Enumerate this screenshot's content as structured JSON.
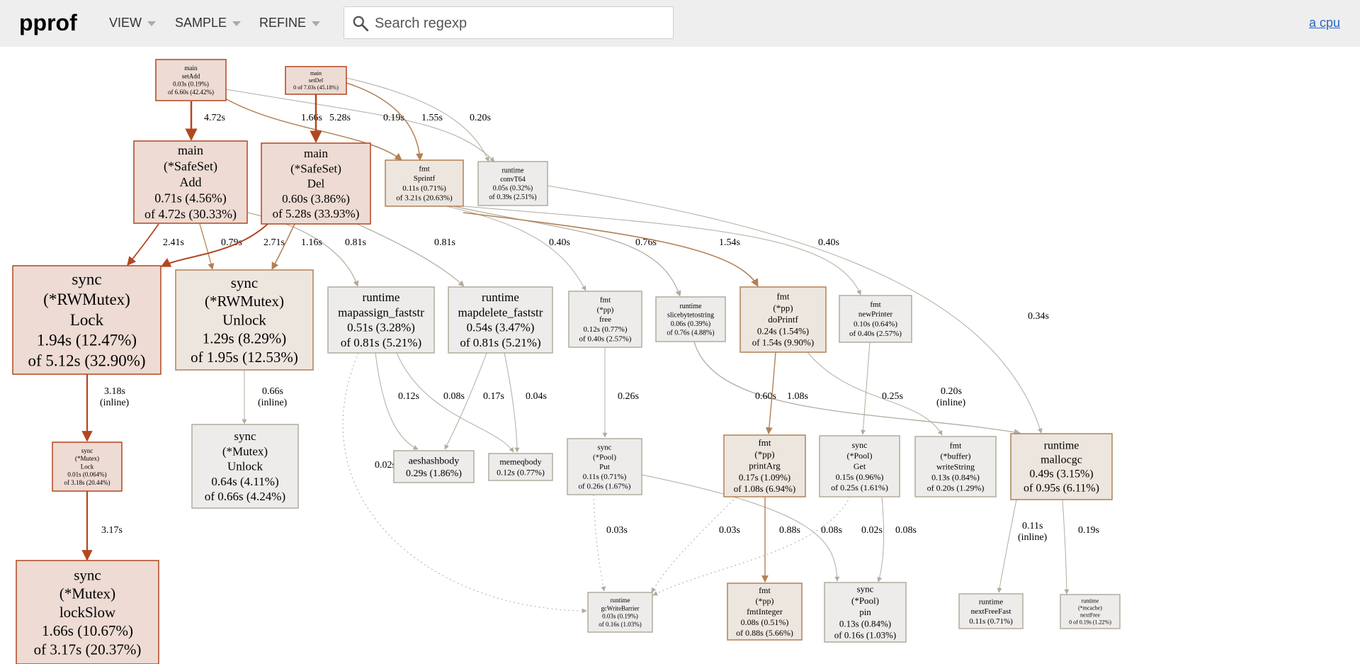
{
  "header": {
    "logo": "pprof",
    "menus": [
      "VIEW",
      "SAMPLE",
      "REFINE"
    ],
    "search_placeholder": "Search regexp",
    "profile_link": "a cpu"
  },
  "colors": {
    "header_bg": "#eeeeee",
    "hot_border": "#b2471f",
    "hot_fill": "#eddbd4",
    "hot_edge": "#b2471f",
    "warm_border": "#b28055",
    "warm_fill": "#ede6df",
    "cold_border": "#b2ac9e",
    "cold_fill": "#edecea",
    "cold_edge": "#b2ac9e",
    "link": "#2a66c8"
  },
  "nodes": [
    {
      "id": "setAdd",
      "lines": [
        "main",
        "setAdd",
        "0.03s (0.19%)",
        "of 6.60s (42.42%)"
      ],
      "heat": "hot"
    },
    {
      "id": "setDel",
      "lines": [
        "main",
        "setDel",
        "0 of 7.03s (45.18%)"
      ],
      "heat": "hot"
    },
    {
      "id": "safeAdd",
      "lines": [
        "main",
        "(*SafeSet)",
        "Add",
        "0.71s (4.56%)",
        "of 4.72s (30.33%)"
      ],
      "heat": "hot"
    },
    {
      "id": "safeDel",
      "lines": [
        "main",
        "(*SafeSet)",
        "Del",
        "0.60s (3.86%)",
        "of 5.28s (33.93%)"
      ],
      "heat": "hot"
    },
    {
      "id": "sprintf",
      "lines": [
        "fmt",
        "Sprintf",
        "0.11s (0.71%)",
        "of 3.21s (20.63%)"
      ],
      "heat": "warm"
    },
    {
      "id": "convT64",
      "lines": [
        "runtime",
        "convT64",
        "0.05s (0.32%)",
        "of 0.39s (2.51%)"
      ],
      "heat": "cold"
    },
    {
      "id": "rwLock",
      "lines": [
        "sync",
        "(*RWMutex)",
        "Lock",
        "1.94s (12.47%)",
        "of 5.12s (32.90%)"
      ],
      "heat": "hot"
    },
    {
      "id": "rwUnlock",
      "lines": [
        "sync",
        "(*RWMutex)",
        "Unlock",
        "1.29s (8.29%)",
        "of 1.95s (12.53%)"
      ],
      "heat": "warm"
    },
    {
      "id": "mapassign",
      "lines": [
        "runtime",
        "mapassign_faststr",
        "0.51s (3.28%)",
        "of 0.81s (5.21%)"
      ],
      "heat": "cold"
    },
    {
      "id": "mapdelete",
      "lines": [
        "runtime",
        "mapdelete_faststr",
        "0.54s (3.47%)",
        "of 0.81s (5.21%)"
      ],
      "heat": "cold"
    },
    {
      "id": "ppfree",
      "lines": [
        "fmt",
        "(*pp)",
        "free",
        "0.12s (0.77%)",
        "of 0.40s (2.57%)"
      ],
      "heat": "cold"
    },
    {
      "id": "slicebyte",
      "lines": [
        "runtime",
        "slicebytetostring",
        "0.06s (0.39%)",
        "of 0.76s (4.88%)"
      ],
      "heat": "cold"
    },
    {
      "id": "doPrintf",
      "lines": [
        "fmt",
        "(*pp)",
        "doPrintf",
        "0.24s (1.54%)",
        "of 1.54s (9.90%)"
      ],
      "heat": "warm"
    },
    {
      "id": "newPrinter",
      "lines": [
        "fmt",
        "newPrinter",
        "0.10s (0.64%)",
        "of 0.40s (2.57%)"
      ],
      "heat": "cold"
    },
    {
      "id": "mutexLock",
      "lines": [
        "sync",
        "(*Mutex)",
        "Lock",
        "0.01s (0.064%)",
        "of 3.18s (20.44%)"
      ],
      "heat": "hot"
    },
    {
      "id": "mutexUnlock",
      "lines": [
        "sync",
        "(*Mutex)",
        "Unlock",
        "0.64s (4.11%)",
        "of 0.66s (4.24%)"
      ],
      "heat": "cold"
    },
    {
      "id": "aeshash",
      "lines": [
        "aeshashbody",
        "0.29s (1.86%)"
      ],
      "heat": "cold"
    },
    {
      "id": "memeq",
      "lines": [
        "memeqbody",
        "0.12s (0.77%)"
      ],
      "heat": "cold"
    },
    {
      "id": "poolPut",
      "lines": [
        "sync",
        "(*Pool)",
        "Put",
        "0.11s (0.71%)",
        "of 0.26s (1.67%)"
      ],
      "heat": "cold"
    },
    {
      "id": "printArg",
      "lines": [
        "fmt",
        "(*pp)",
        "printArg",
        "0.17s (1.09%)",
        "of 1.08s (6.94%)"
      ],
      "heat": "warm"
    },
    {
      "id": "poolGet",
      "lines": [
        "sync",
        "(*Pool)",
        "Get",
        "0.15s (0.96%)",
        "of 0.25s (1.61%)"
      ],
      "heat": "cold"
    },
    {
      "id": "writeString",
      "lines": [
        "fmt",
        "(*buffer)",
        "writeString",
        "0.13s (0.84%)",
        "of 0.20s (1.29%)"
      ],
      "heat": "cold"
    },
    {
      "id": "mallocgc",
      "lines": [
        "runtime",
        "mallocgc",
        "0.49s (3.15%)",
        "of 0.95s (6.11%)"
      ],
      "heat": "warm"
    },
    {
      "id": "lockSlow",
      "lines": [
        "sync",
        "(*Mutex)",
        "lockSlow",
        "1.66s (10.67%)",
        "of 3.17s (20.37%)"
      ],
      "heat": "hot"
    },
    {
      "id": "gcWB",
      "lines": [
        "runtime",
        "gcWriteBarrier",
        "0.03s (0.19%)",
        "of 0.16s (1.03%)"
      ],
      "heat": "cold"
    },
    {
      "id": "fmtInteger",
      "lines": [
        "fmt",
        "(*pp)",
        "fmtInteger",
        "0.08s (0.51%)",
        "of 0.88s (5.66%)"
      ],
      "heat": "warm"
    },
    {
      "id": "poolPin",
      "lines": [
        "sync",
        "(*Pool)",
        "pin",
        "0.13s (0.84%)",
        "of 0.16s (1.03%)"
      ],
      "heat": "cold"
    },
    {
      "id": "nextFreeFast",
      "lines": [
        "runtime",
        "nextFreeFast",
        "0.11s (0.71%)"
      ],
      "heat": "cold"
    },
    {
      "id": "mcacheNextFree",
      "lines": [
        "runtime",
        "(*mcache)",
        "nextFree",
        "0 of 0.19s (1.22%)"
      ],
      "heat": "cold"
    }
  ],
  "edges": [
    {
      "from": "setAdd",
      "to": "safeAdd",
      "label": "4.72s"
    },
    {
      "from": "setAdd",
      "to": "sprintf",
      "label": "1.66s"
    },
    {
      "from": "setAdd",
      "to": "convT64",
      "label": "0.19s"
    },
    {
      "from": "setDel",
      "to": "safeDel",
      "label": "5.28s"
    },
    {
      "from": "setDel",
      "to": "sprintf",
      "label": "1.55s"
    },
    {
      "from": "setDel",
      "to": "convT64",
      "label": "0.20s"
    },
    {
      "from": "safeAdd",
      "to": "rwLock",
      "label": "2.41s"
    },
    {
      "from": "safeAdd",
      "to": "rwUnlock",
      "label": "0.79s"
    },
    {
      "from": "safeAdd",
      "to": "mapassign",
      "label": "0.81s"
    },
    {
      "from": "safeDel",
      "to": "rwLock",
      "label": "2.71s"
    },
    {
      "from": "safeDel",
      "to": "rwUnlock",
      "label": "1.16s"
    },
    {
      "from": "safeDel",
      "to": "mapdelete",
      "label": "0.81s"
    },
    {
      "from": "sprintf",
      "to": "ppfree",
      "label": "0.40s"
    },
    {
      "from": "sprintf",
      "to": "slicebyte",
      "label": "0.76s"
    },
    {
      "from": "sprintf",
      "to": "doPrintf",
      "label": "1.54s"
    },
    {
      "from": "sprintf",
      "to": "newPrinter",
      "label": "0.40s"
    },
    {
      "from": "convT64",
      "to": "mallocgc",
      "label": "0.34s"
    },
    {
      "from": "rwLock",
      "to": "mutexLock",
      "label": "3.18s",
      "label2": "(inline)"
    },
    {
      "from": "rwUnlock",
      "to": "mutexUnlock",
      "label": "0.66s",
      "label2": "(inline)"
    },
    {
      "from": "mapassign",
      "to": "aeshash",
      "label": "0.12s"
    },
    {
      "from": "mapassign",
      "to": "memeq",
      "label": "0.08s"
    },
    {
      "from": "mapassign",
      "to": "gcWB",
      "label": "0.02s"
    },
    {
      "from": "mapdelete",
      "to": "aeshash",
      "label": "0.17s"
    },
    {
      "from": "mapdelete",
      "to": "memeq",
      "label": "0.04s"
    },
    {
      "from": "ppfree",
      "to": "poolPut",
      "label": "0.26s"
    },
    {
      "from": "slicebyte",
      "to": "mallocgc",
      "label": "0.60s"
    },
    {
      "from": "doPrintf",
      "to": "printArg",
      "label": "1.08s"
    },
    {
      "from": "doPrintf",
      "to": "writeString",
      "label": "0.20s",
      "label2": "(inline)"
    },
    {
      "from": "newPrinter",
      "to": "poolGet",
      "label": "0.25s"
    },
    {
      "from": "mutexLock",
      "to": "lockSlow",
      "label": "3.17s"
    },
    {
      "from": "poolPut",
      "to": "gcWB",
      "label": "0.03s"
    },
    {
      "from": "poolPut",
      "to": "poolPin",
      "label": "0.08s"
    },
    {
      "from": "printArg",
      "to": "gcWB",
      "label": "0.03s"
    },
    {
      "from": "printArg",
      "to": "fmtInteger",
      "label": "0.88s"
    },
    {
      "from": "poolGet",
      "to": "gcWB",
      "label": "0.02s"
    },
    {
      "from": "poolGet",
      "to": "poolPin",
      "label": "0.08s"
    },
    {
      "from": "mallocgc",
      "to": "nextFreeFast",
      "label": "0.11s",
      "label2": "(inline)"
    },
    {
      "from": "mallocgc",
      "to": "mcacheNextFree",
      "label": "0.19s"
    }
  ]
}
